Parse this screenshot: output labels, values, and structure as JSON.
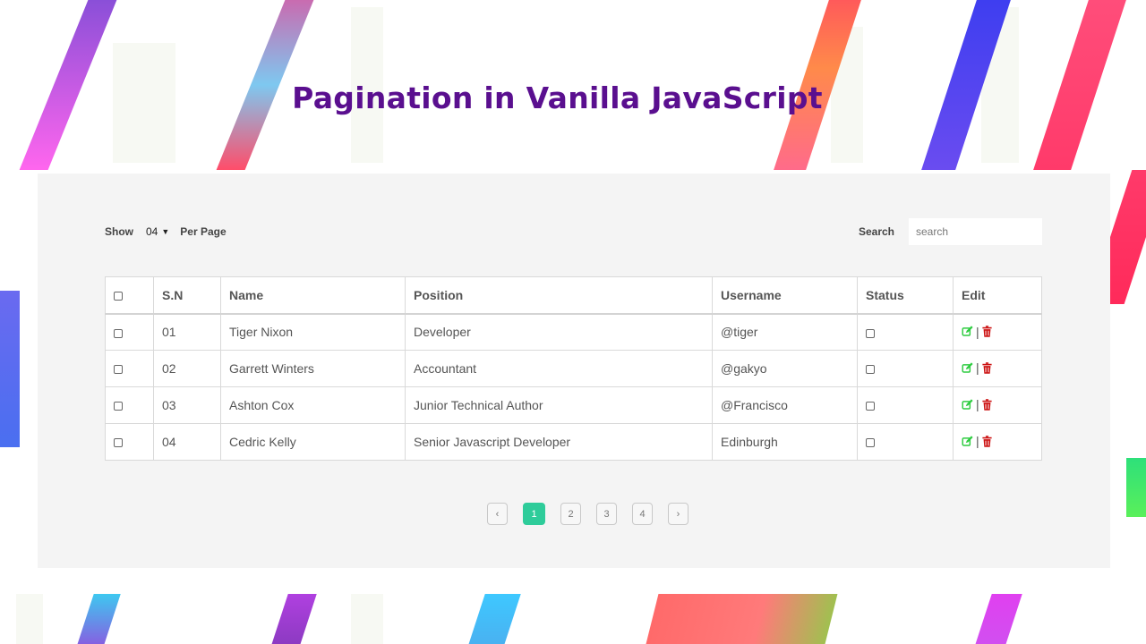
{
  "title": "Pagination in Vanilla JavaScript",
  "toolbar": {
    "show_label": "Show",
    "per_page_value": "04",
    "per_page_label": "Per Page",
    "search_label": "Search",
    "search_placeholder": "search"
  },
  "table": {
    "headers": [
      "S.N",
      "Name",
      "Position",
      "Username",
      "Status",
      "Edit"
    ],
    "rows": [
      {
        "sn": "01",
        "name": "Tiger Nixon",
        "position": "Developer",
        "username": "@tiger"
      },
      {
        "sn": "02",
        "name": "Garrett Winters",
        "position": "Accountant",
        "username": "@gakyo"
      },
      {
        "sn": "03",
        "name": "Ashton Cox",
        "position": "Junior Technical Author",
        "username": "@Francisco"
      },
      {
        "sn": "04",
        "name": "Cedric Kelly",
        "position": "Senior Javascript Developer",
        "username": "Edinburgh"
      }
    ],
    "edit_separator": "|"
  },
  "pagination": {
    "prev": "‹",
    "pages": [
      "1",
      "2",
      "3",
      "4"
    ],
    "active_page": "1",
    "next": "›"
  },
  "colors": {
    "title": "#5a0f8f",
    "active_page": "#2ecc9a",
    "edit_icon": "#2ecc40",
    "delete_icon": "#cc1111"
  },
  "icons": {
    "edit": "pencil-square-icon",
    "delete": "trash-icon",
    "select": "chevron-down-icon"
  }
}
